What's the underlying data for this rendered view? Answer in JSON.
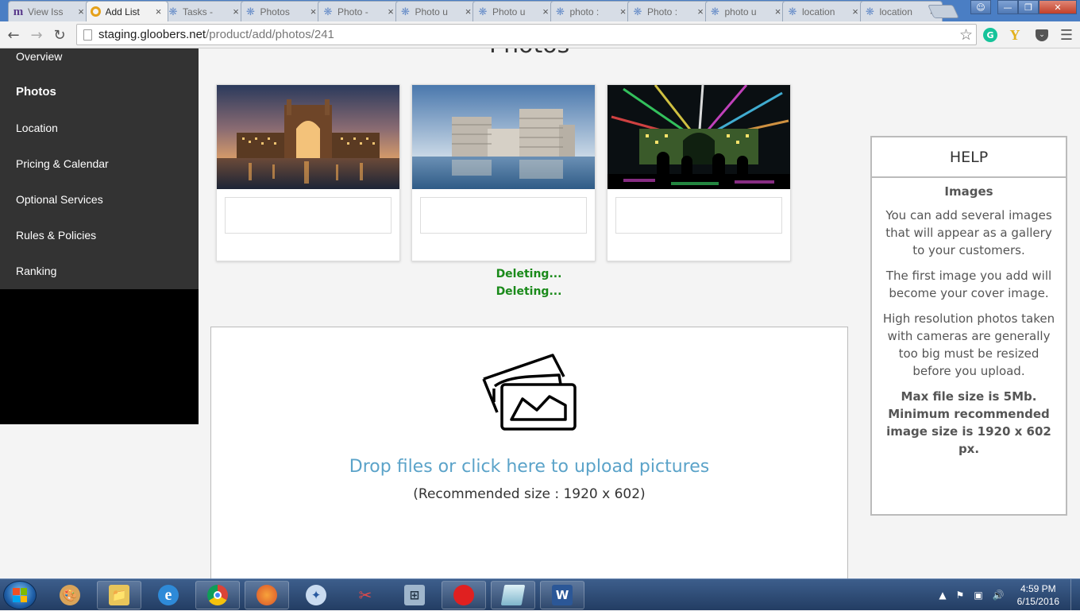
{
  "browser": {
    "tabs": [
      {
        "title": "View Iss",
        "icon": "m-logo-icon",
        "active": false
      },
      {
        "title": "Add List",
        "icon": "gloobers-logo-icon",
        "active": true
      },
      {
        "title": "Tasks -",
        "icon": "star-logo-icon",
        "active": false
      },
      {
        "title": "Photos",
        "icon": "star-logo-icon",
        "active": false
      },
      {
        "title": "Photo -",
        "icon": "star-logo-icon",
        "active": false
      },
      {
        "title": "Photo u",
        "icon": "star-logo-icon",
        "active": false
      },
      {
        "title": "Photo u",
        "icon": "star-logo-icon",
        "active": false
      },
      {
        "title": "photo :",
        "icon": "star-logo-icon",
        "active": false
      },
      {
        "title": "Photo :",
        "icon": "star-logo-icon",
        "active": false
      },
      {
        "title": "photo u",
        "icon": "star-logo-icon",
        "active": false
      },
      {
        "title": "location",
        "icon": "star-logo-icon",
        "active": false
      },
      {
        "title": "location",
        "icon": "star-logo-icon",
        "active": false
      }
    ],
    "url_host": "staging.gloobers.net",
    "url_path": "/product/add/photos/241"
  },
  "sidebar": {
    "items": [
      {
        "label": "Overview",
        "active": false
      },
      {
        "label": "Photos",
        "active": true
      },
      {
        "label": "Location",
        "active": false
      },
      {
        "label": "Pricing & Calendar",
        "active": false
      },
      {
        "label": "Optional Services",
        "active": false
      },
      {
        "label": "Rules & Policies",
        "active": false
      },
      {
        "label": "Ranking",
        "active": false
      }
    ]
  },
  "main": {
    "heading": "Photos",
    "photos": [
      {
        "caption": ""
      },
      {
        "caption": ""
      },
      {
        "caption": ""
      }
    ],
    "status_lines": [
      "Deleting...",
      "Deleting..."
    ],
    "dropzone": {
      "text": "Drop files or click here to upload pictures",
      "hint": "(Recommended size : 1920 x 602)"
    }
  },
  "help": {
    "title": "HELP",
    "subtitle": "Images",
    "paragraph_1": "You can add several images that will appear as a gallery to your customers.",
    "paragraph_2": "The first image you add will become your cover image.",
    "paragraph_3": "High resolution photos taken with cameras are generally too big must be resized before you upload.",
    "paragraph_4": "Max file size is 5Mb. Minimum recommended image size is 1920 x 602 px."
  },
  "taskbar": {
    "time": "4:59 PM",
    "date": "6/15/2016"
  },
  "colors": {
    "sidebar_bg": "#333333",
    "link_blue": "#5ba3c9",
    "status_green": "#1a8a1a"
  }
}
